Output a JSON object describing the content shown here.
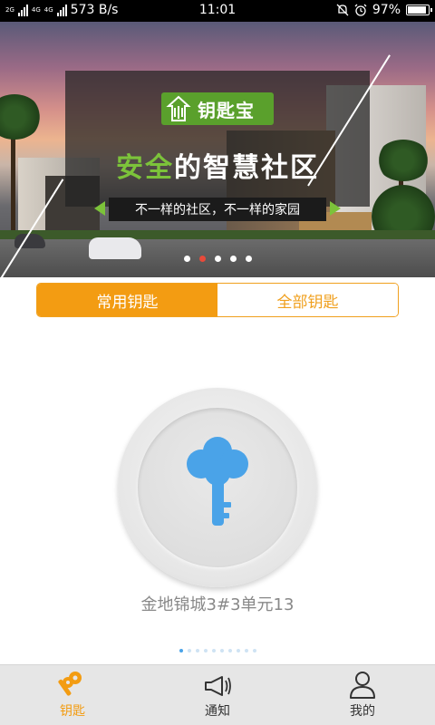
{
  "status_bar": {
    "network_small": "2G",
    "network_4g_a": "4G",
    "network_4g_b": "4G",
    "speed": "573 B/s",
    "time": "11:01",
    "battery_percent": "97%",
    "battery_level": 0.97,
    "icons": [
      "signal-icon",
      "signal-icon",
      "mute-bell-icon",
      "alarm-icon",
      "battery-icon"
    ]
  },
  "banner": {
    "logo_text": "钥匙宝",
    "headline_accent": "安全",
    "headline_rest": "的智慧社区",
    "subline": "不一样的社区，不一样的家园",
    "carousel_count": 5,
    "carousel_active": 1
  },
  "tabs_segment": {
    "common_keys": "常用钥匙",
    "all_keys": "全部钥匙",
    "selected": "common_keys"
  },
  "key": {
    "label": "金地锦城3#3单元13",
    "icon": "key-icon",
    "color": "#4aa3e8"
  },
  "pager": {
    "count": 10,
    "active": 0
  },
  "bottom_nav": {
    "items": [
      {
        "label": "钥匙",
        "icon": "keys-icon",
        "active": true
      },
      {
        "label": "通知",
        "icon": "megaphone-icon",
        "active": false
      },
      {
        "label": "我的",
        "icon": "user-icon",
        "active": false
      }
    ]
  },
  "colors": {
    "accent": "#f39c12",
    "key_blue": "#4aa3e8",
    "logo_green": "#5aa02c"
  }
}
